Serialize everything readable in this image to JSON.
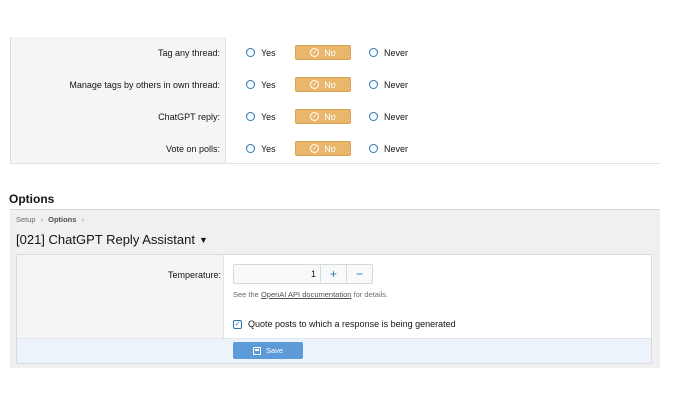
{
  "permissions": {
    "rows": [
      {
        "label": "Tag any thread:",
        "yes": "Yes",
        "no": "No",
        "never": "Never",
        "selected": "No"
      },
      {
        "label": "Manage tags by others in own thread:",
        "yes": "Yes",
        "no": "No",
        "never": "Never",
        "selected": "No"
      },
      {
        "label": "ChatGPT reply:",
        "yes": "Yes",
        "no": "No",
        "never": "Never",
        "selected": "No"
      },
      {
        "label": "Vote on polls:",
        "yes": "Yes",
        "no": "No",
        "never": "Never",
        "selected": "No"
      }
    ]
  },
  "options_heading": "Options",
  "breadcrumb": {
    "items": [
      "Setup",
      "Options"
    ]
  },
  "page_title": "[021] ChatGPT Reply Assistant",
  "form": {
    "temperature_label": "Temperature:",
    "temperature_value": "1",
    "plus": "+",
    "minus": "−",
    "hint_prefix": "See the ",
    "hint_link": "OpenAI API documentation",
    "hint_suffix": " for details.",
    "quote_label": "Quote posts to which a response is being generated",
    "quote_checked": true,
    "save_label": "Save"
  },
  "colors": {
    "selected_no": "#e9b66b",
    "accent": "#2577b1",
    "save_button": "#5c9ad8"
  }
}
